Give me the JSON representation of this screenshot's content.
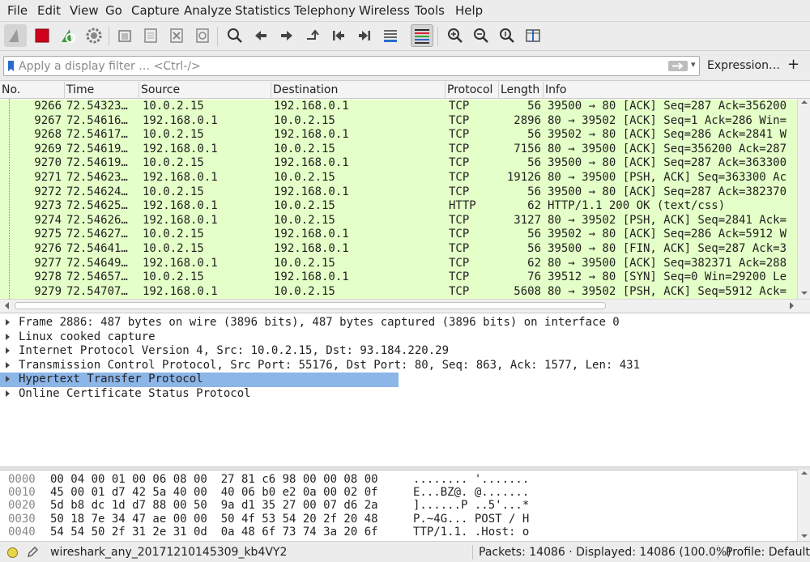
{
  "menu": [
    "File",
    "Edit",
    "View",
    "Go",
    "Capture",
    "Analyze",
    "Statistics",
    "Telephony",
    "Wireless",
    "Tools",
    "Help"
  ],
  "filter": {
    "placeholder": "Apply a display filter … <Ctrl-/>",
    "expression_label": "Expression…",
    "add_label": "+"
  },
  "columns": [
    "No.",
    "Time",
    "Source",
    "Destination",
    "Protocol",
    "Length",
    "Info"
  ],
  "packets": [
    {
      "no": "9266",
      "time": "72.54323…",
      "src": "10.0.2.15",
      "dst": "192.168.0.1",
      "proto": "TCP",
      "len": "56",
      "info": "39500 → 80 [ACK] Seq=287 Ack=356200"
    },
    {
      "no": "9267",
      "time": "72.54616…",
      "src": "192.168.0.1",
      "dst": "10.0.2.15",
      "proto": "TCP",
      "len": "2896",
      "info": "80 → 39502 [ACK] Seq=1 Ack=286 Win="
    },
    {
      "no": "9268",
      "time": "72.54617…",
      "src": "10.0.2.15",
      "dst": "192.168.0.1",
      "proto": "TCP",
      "len": "56",
      "info": "39502 → 80 [ACK] Seq=286 Ack=2841 W"
    },
    {
      "no": "9269",
      "time": "72.54619…",
      "src": "192.168.0.1",
      "dst": "10.0.2.15",
      "proto": "TCP",
      "len": "7156",
      "info": "80 → 39500 [ACK] Seq=356200 Ack=287"
    },
    {
      "no": "9270",
      "time": "72.54619…",
      "src": "10.0.2.15",
      "dst": "192.168.0.1",
      "proto": "TCP",
      "len": "56",
      "info": "39500 → 80 [ACK] Seq=287 Ack=363300"
    },
    {
      "no": "9271",
      "time": "72.54623…",
      "src": "192.168.0.1",
      "dst": "10.0.2.15",
      "proto": "TCP",
      "len": "19126",
      "info": "80 → 39500 [PSH, ACK] Seq=363300 Ac"
    },
    {
      "no": "9272",
      "time": "72.54624…",
      "src": "10.0.2.15",
      "dst": "192.168.0.1",
      "proto": "TCP",
      "len": "56",
      "info": "39500 → 80 [ACK] Seq=287 Ack=382370"
    },
    {
      "no": "9273",
      "time": "72.54625…",
      "src": "192.168.0.1",
      "dst": "10.0.2.15",
      "proto": "HTTP",
      "len": "62",
      "info": "HTTP/1.1 200 OK  (text/css)"
    },
    {
      "no": "9274",
      "time": "72.54626…",
      "src": "192.168.0.1",
      "dst": "10.0.2.15",
      "proto": "TCP",
      "len": "3127",
      "info": "80 → 39502 [PSH, ACK] Seq=2841 Ack="
    },
    {
      "no": "9275",
      "time": "72.54627…",
      "src": "10.0.2.15",
      "dst": "192.168.0.1",
      "proto": "TCP",
      "len": "56",
      "info": "39502 → 80 [ACK] Seq=286 Ack=5912 W"
    },
    {
      "no": "9276",
      "time": "72.54641…",
      "src": "10.0.2.15",
      "dst": "192.168.0.1",
      "proto": "TCP",
      "len": "56",
      "info": "39500 → 80 [FIN, ACK] Seq=287 Ack=3"
    },
    {
      "no": "9277",
      "time": "72.54649…",
      "src": "192.168.0.1",
      "dst": "10.0.2.15",
      "proto": "TCP",
      "len": "62",
      "info": "80 → 39500 [ACK] Seq=382371 Ack=288"
    },
    {
      "no": "9278",
      "time": "72.54657…",
      "src": "10.0.2.15",
      "dst": "192.168.0.1",
      "proto": "TCP",
      "len": "76",
      "info": "39512 → 80 [SYN] Seq=0 Win=29200 Le"
    },
    {
      "no": "9279",
      "time": "72.54707…",
      "src": "192.168.0.1",
      "dst": "10.0.2.15",
      "proto": "TCP",
      "len": "5608",
      "info": "80 → 39502 [PSH, ACK] Seq=5912 Ack="
    }
  ],
  "details": [
    {
      "text": "Frame 2886: 487 bytes on wire (3896 bits), 487 bytes captured (3896 bits) on interface 0",
      "selected": false
    },
    {
      "text": "Linux cooked capture",
      "selected": false
    },
    {
      "text": "Internet Protocol Version 4, Src: 10.0.2.15, Dst: 93.184.220.29",
      "selected": false
    },
    {
      "text": "Transmission Control Protocol, Src Port: 55176, Dst Port: 80, Seq: 863, Ack: 1577, Len: 431",
      "selected": false
    },
    {
      "text": "Hypertext Transfer Protocol",
      "selected": true
    },
    {
      "text": "Online Certificate Status Protocol",
      "selected": false
    }
  ],
  "hex": [
    {
      "offset": "0000",
      "bytes": "00 04 00 01 00 06 08 00  27 81 c6 98 00 00 08 00",
      "ascii": "........ '......."
    },
    {
      "offset": "0010",
      "bytes": "45 00 01 d7 42 5a 40 00  40 06 b0 e2 0a 00 02 0f",
      "ascii": "E...BZ@. @......."
    },
    {
      "offset": "0020",
      "bytes": "5d b8 dc 1d d7 88 00 50  9a d1 35 27 00 07 d6 2a",
      "ascii": "]......P ..5'...*"
    },
    {
      "offset": "0030",
      "bytes": "50 18 7e 34 47 ae 00 00  50 4f 53 54 20 2f 20 48",
      "ascii": "P.~4G... POST / H"
    },
    {
      "offset": "0040",
      "bytes": "54 54 50 2f 31 2e 31 0d  0a 48 6f 73 74 3a 20 6f",
      "ascii": "TTP/1.1. .Host: o"
    }
  ],
  "status": {
    "file": "wireshark_any_20171210145309_kb4VY2",
    "packets": "Packets: 14086 · Displayed: 14086 (100.0%)",
    "profile": "Profile: Default"
  },
  "colors": {
    "row_bg": "#e4ffc7",
    "selected_detail": "#8cb5e8",
    "stop_red": "#d0021b",
    "shark_green": "#3c9a3c"
  }
}
